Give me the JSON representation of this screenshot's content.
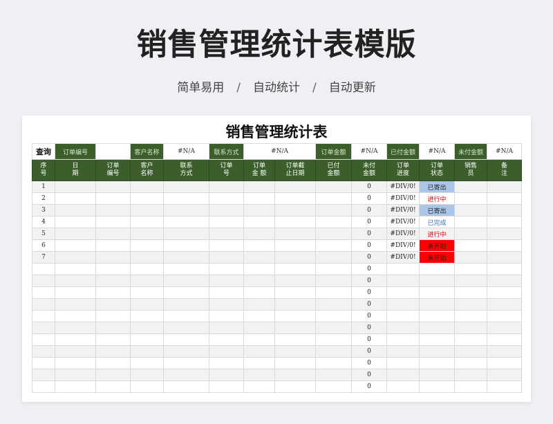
{
  "hero": {
    "title": "销售管理统计表模版",
    "subtitle": [
      "简单易用",
      "自动统计",
      "自动更新"
    ],
    "separator": "/"
  },
  "sheet": {
    "title": "销售管理统计表",
    "query": {
      "label": "查询",
      "fields": [
        {
          "label": "订单编号",
          "value": ""
        },
        {
          "label": "客户名称",
          "value": "#N/A"
        },
        {
          "label": "联系方式",
          "value": "#N/A"
        },
        {
          "label": "订单金额",
          "value": "#N/A"
        },
        {
          "label": "已付金额",
          "value": "#N/A"
        },
        {
          "label": "未付金额",
          "value": "#N/A"
        }
      ]
    },
    "headers": [
      "序号",
      "日期",
      "订单编号",
      "客户名称",
      "联系方式",
      "订单号",
      "订单金额",
      "订单截止日期",
      "已付金额",
      "未付金额",
      "订单进度",
      "订单状态",
      "销售员",
      "备注"
    ],
    "header_lines": [
      [
        "序",
        "号"
      ],
      [
        "日",
        "期"
      ],
      [
        "订单",
        "编号"
      ],
      [
        "客户",
        "名称"
      ],
      [
        "联系",
        "方式"
      ],
      [
        "订单",
        "号"
      ],
      [
        "订单",
        "金 额"
      ],
      [
        "订单截",
        "止日期"
      ],
      [
        "已付",
        "金额"
      ],
      [
        "未付",
        "金额"
      ],
      [
        "订单",
        "进度"
      ],
      [
        "订单",
        "状态"
      ],
      [
        "销售",
        "员"
      ],
      [
        "备",
        "注"
      ]
    ],
    "rows": [
      {
        "seq": "1",
        "unpaid": "0",
        "progress": "#DIV/0!",
        "status": "已寄出",
        "status_style": "st-blue"
      },
      {
        "seq": "2",
        "unpaid": "0",
        "progress": "#DIV/0!",
        "status": "进行中",
        "status_style": "st-red-text"
      },
      {
        "seq": "3",
        "unpaid": "0",
        "progress": "#DIV/0!",
        "status": "已寄出",
        "status_style": "st-blue"
      },
      {
        "seq": "4",
        "unpaid": "0",
        "progress": "#DIV/0!",
        "status": "已完成",
        "status_style": "st-blue-text"
      },
      {
        "seq": "5",
        "unpaid": "0",
        "progress": "#DIV/0!",
        "status": "进行中",
        "status_style": "st-red-text"
      },
      {
        "seq": "6",
        "unpaid": "0",
        "progress": "#DIV/0!",
        "status": "未开始",
        "status_style": "st-red"
      },
      {
        "seq": "7",
        "unpaid": "0",
        "progress": "#DIV/0!",
        "status": "未开始",
        "status_style": "st-red"
      },
      {
        "seq": "",
        "unpaid": "0",
        "progress": "",
        "status": "",
        "status_style": ""
      },
      {
        "seq": "",
        "unpaid": "0",
        "progress": "",
        "status": "",
        "status_style": ""
      },
      {
        "seq": "",
        "unpaid": "0",
        "progress": "",
        "status": "",
        "status_style": ""
      },
      {
        "seq": "",
        "unpaid": "0",
        "progress": "",
        "status": "",
        "status_style": ""
      },
      {
        "seq": "",
        "unpaid": "0",
        "progress": "",
        "status": "",
        "status_style": ""
      },
      {
        "seq": "",
        "unpaid": "0",
        "progress": "",
        "status": "",
        "status_style": ""
      },
      {
        "seq": "",
        "unpaid": "0",
        "progress": "",
        "status": "",
        "status_style": ""
      },
      {
        "seq": "",
        "unpaid": "0",
        "progress": "",
        "status": "",
        "status_style": ""
      },
      {
        "seq": "",
        "unpaid": "0",
        "progress": "",
        "status": "",
        "status_style": ""
      },
      {
        "seq": "",
        "unpaid": "0",
        "progress": "",
        "status": "",
        "status_style": ""
      },
      {
        "seq": "",
        "unpaid": "0",
        "progress": "",
        "status": "",
        "status_style": ""
      }
    ],
    "colors": {
      "header_green": "#3b5e2b",
      "status_blue": "#a9c6e8",
      "status_red": "#ff0000"
    }
  }
}
